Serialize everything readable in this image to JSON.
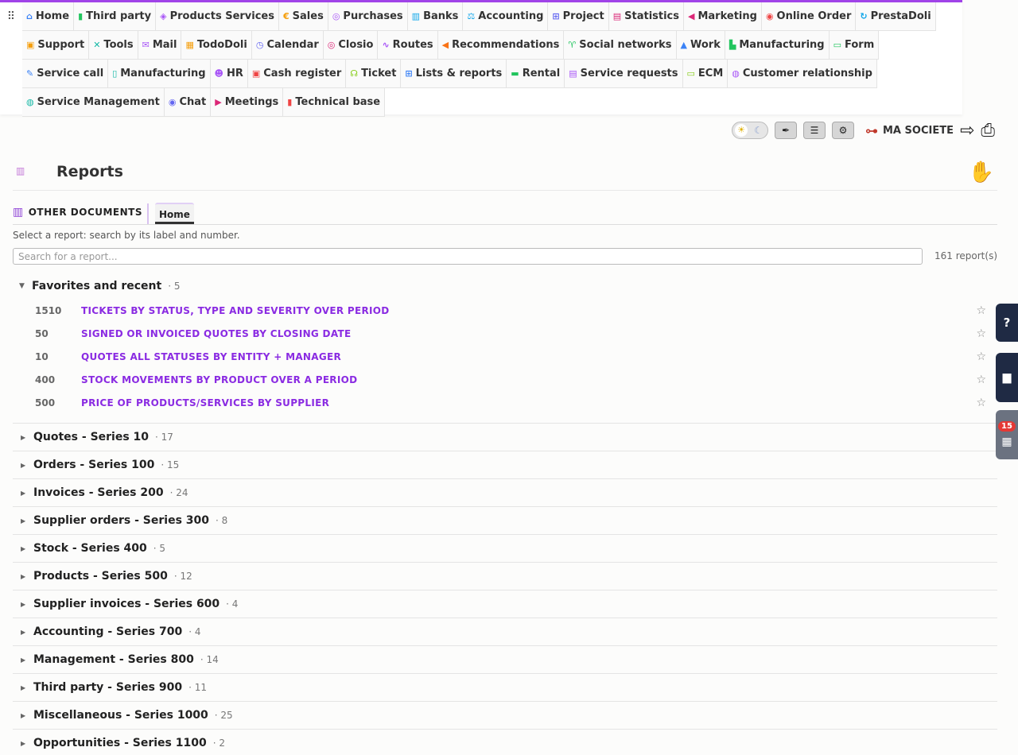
{
  "menu": [
    {
      "id": "home",
      "label": "Home",
      "icon": "home-icon",
      "color": "#3b82f6",
      "glyph": "⌂"
    },
    {
      "id": "third-party",
      "label": "Third party",
      "icon": "building-icon",
      "color": "#22c55e",
      "glyph": "▮"
    },
    {
      "id": "products-services",
      "label": "Products Services",
      "icon": "cubes-icon",
      "color": "#a855f7",
      "glyph": "◈"
    },
    {
      "id": "sales",
      "label": "Sales",
      "icon": "euro-icon",
      "color": "#f59e0b",
      "glyph": "€"
    },
    {
      "id": "purchases",
      "label": "Purchases",
      "icon": "coins-icon",
      "color": "#a855f7",
      "glyph": "◎"
    },
    {
      "id": "banks",
      "label": "Banks",
      "icon": "bank-icon",
      "color": "#0ea5e9",
      "glyph": "▥"
    },
    {
      "id": "accounting",
      "label": "Accounting",
      "icon": "balance-icon",
      "color": "#0ea5e9",
      "glyph": "⚖"
    },
    {
      "id": "project",
      "label": "Project",
      "icon": "sitemap-icon",
      "color": "#6366f1",
      "glyph": "⊞"
    },
    {
      "id": "statistics",
      "label": "Statistics",
      "icon": "chart-icon",
      "color": "#db2777",
      "glyph": "▤"
    },
    {
      "id": "marketing",
      "label": "Marketing",
      "icon": "bullhorn-icon",
      "color": "#db2777",
      "glyph": "◀"
    },
    {
      "id": "online-order",
      "label": "Online Order",
      "icon": "order-icon",
      "color": "#ef4444",
      "glyph": "◉"
    },
    {
      "id": "prestadoli",
      "label": "PrestaDoli",
      "icon": "sync-icon",
      "color": "#0ea5e9",
      "glyph": "↻"
    },
    {
      "id": "support",
      "label": "Support",
      "icon": "briefcase-icon",
      "color": "#f59e0b",
      "glyph": "▣"
    },
    {
      "id": "tools",
      "label": "Tools",
      "icon": "tools-icon",
      "color": "#14b8a6",
      "glyph": "✕"
    },
    {
      "id": "mail",
      "label": "Mail",
      "icon": "mail-icon",
      "color": "#a855f7",
      "glyph": "✉"
    },
    {
      "id": "tododoli",
      "label": "TodoDoli",
      "icon": "todo-icon",
      "color": "#f59e0b",
      "glyph": "▦"
    },
    {
      "id": "calendar",
      "label": "Calendar",
      "icon": "clock-icon",
      "color": "#6366f1",
      "glyph": "◷"
    },
    {
      "id": "closio",
      "label": "Closio",
      "icon": "target-icon",
      "color": "#db2777",
      "glyph": "◎"
    },
    {
      "id": "routes",
      "label": "Routes",
      "icon": "route-icon",
      "color": "#a855f7",
      "glyph": "∿"
    },
    {
      "id": "recommendations",
      "label": "Recommendations",
      "icon": "megaphone-icon",
      "color": "#f97316",
      "glyph": "◀"
    },
    {
      "id": "social-networks",
      "label": "Social networks",
      "icon": "antenna-icon",
      "color": "#22c55e",
      "glyph": "♈"
    },
    {
      "id": "work",
      "label": "Work",
      "icon": "road-icon",
      "color": "#3b82f6",
      "glyph": "▲"
    },
    {
      "id": "manufacturing",
      "label": "Manufacturing",
      "icon": "industry-icon",
      "color": "#22c55e",
      "glyph": "▙"
    },
    {
      "id": "form",
      "label": "Form",
      "icon": "form-icon",
      "color": "#22c55e",
      "glyph": "▭"
    },
    {
      "id": "service-call",
      "label": "Service call",
      "icon": "wrench-icon",
      "color": "#3b82f6",
      "glyph": "✎"
    },
    {
      "id": "manufacturing-2",
      "label": "Manufacturing",
      "icon": "cylinder-icon",
      "color": "#14b8a6",
      "glyph": "▯"
    },
    {
      "id": "hr",
      "label": "HR",
      "icon": "users-icon",
      "color": "#a855f7",
      "glyph": "☻"
    },
    {
      "id": "cash-register",
      "label": "Cash register",
      "icon": "cash-register-icon",
      "color": "#ef4444",
      "glyph": "▣"
    },
    {
      "id": "ticket",
      "label": "Ticket",
      "icon": "headset-icon",
      "color": "#84cc16",
      "glyph": "☊"
    },
    {
      "id": "lists-reports",
      "label": "Lists & reports",
      "icon": "table-icon",
      "color": "#3b82f6",
      "glyph": "⊞"
    },
    {
      "id": "rental",
      "label": "Rental",
      "icon": "truck-icon",
      "color": "#22c55e",
      "glyph": "▬"
    },
    {
      "id": "service-requests",
      "label": "Service requests",
      "icon": "file-icon",
      "color": "#a855f7",
      "glyph": "▤"
    },
    {
      "id": "ecm",
      "label": "ECM",
      "icon": "folder-icon",
      "color": "#84cc16",
      "glyph": "▭"
    },
    {
      "id": "customer-relationship",
      "label": "Customer relationship",
      "icon": "handshake-icon",
      "color": "#a855f7",
      "glyph": "◍"
    },
    {
      "id": "service-management",
      "label": "Service Management",
      "icon": "handshake-icon",
      "color": "#14b8a6",
      "glyph": "◍"
    },
    {
      "id": "chat",
      "label": "Chat",
      "icon": "comments-icon",
      "color": "#6366f1",
      "glyph": "◉"
    },
    {
      "id": "meetings",
      "label": "Meetings",
      "icon": "video-icon",
      "color": "#db2777",
      "glyph": "▶"
    },
    {
      "id": "technical-base",
      "label": "Technical base",
      "icon": "book-icon",
      "color": "#ef4444",
      "glyph": "▮"
    }
  ],
  "toolbar": {
    "company": "MA SOCIETE"
  },
  "page": {
    "title": "Reports"
  },
  "tabs": {
    "section_label": "OTHER DOCUMENTS",
    "active": "Home"
  },
  "search": {
    "hint": "Select a report: search by its label and number.",
    "placeholder": "Search for a report...",
    "count": "161 report(s)"
  },
  "favorites": {
    "name": "Favorites and recent",
    "count": "· 5",
    "items": [
      {
        "num": "1510",
        "label": "TICKETS BY STATUS, TYPE AND SEVERITY OVER PERIOD"
      },
      {
        "num": "50",
        "label": "SIGNED OR INVOICED QUOTES BY CLOSING DATE"
      },
      {
        "num": "10",
        "label": "QUOTES ALL STATUSES BY ENTITY + MANAGER"
      },
      {
        "num": "400",
        "label": "STOCK MOVEMENTS BY PRODUCT OVER A PERIOD"
      },
      {
        "num": "500",
        "label": "PRICE OF PRODUCTS/SERVICES BY SUPPLIER"
      }
    ]
  },
  "series": [
    {
      "name": "Quotes - Series 10",
      "count": "· 17"
    },
    {
      "name": "Orders - Series 100",
      "count": "· 15"
    },
    {
      "name": "Invoices - Series 200",
      "count": "· 24"
    },
    {
      "name": "Supplier orders - Series 300",
      "count": "· 8"
    },
    {
      "name": "Stock - Series 400",
      "count": "· 5"
    },
    {
      "name": "Products - Series 500",
      "count": "· 12"
    },
    {
      "name": "Supplier invoices - Series 600",
      "count": "· 4"
    },
    {
      "name": "Accounting - Series 700",
      "count": "· 4"
    },
    {
      "name": "Management - Series 800",
      "count": "· 14"
    },
    {
      "name": "Third party - Series 900",
      "count": "· 11"
    },
    {
      "name": "Miscellaneous - Series 1000",
      "count": "· 25"
    },
    {
      "name": "Opportunities - Series 1100",
      "count": "· 2"
    }
  ],
  "floating": {
    "agenda_badge": "15"
  }
}
